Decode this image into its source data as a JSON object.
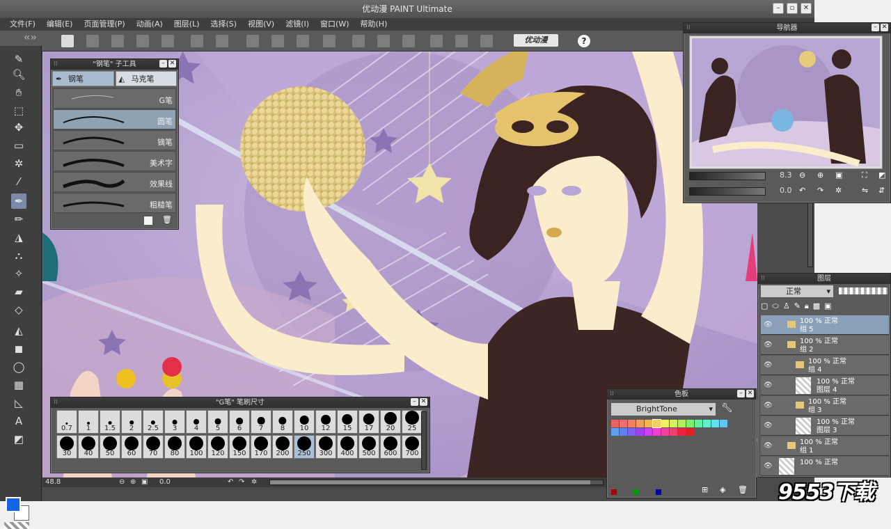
{
  "app": {
    "title": "优动漫 PAINT Ultimate"
  },
  "menu": [
    "文件(F)",
    "编辑(E)",
    "页面管理(P)",
    "动画(A)",
    "图层(L)",
    "选择(S)",
    "视图(V)",
    "滤镜(I)",
    "窗口(W)",
    "帮助(H)"
  ],
  "toolbar": {
    "logo": "优动漫",
    "help": "?"
  },
  "subtool_panel": {
    "title": "\"钢笔\" 子工具",
    "tabs": [
      "钢笔",
      "马克笔"
    ],
    "brushes": [
      "G笔",
      "圆笔",
      "镝笔",
      "美术字",
      "效果线",
      "粗糙笔"
    ],
    "selected_brush": "圆笔"
  },
  "brush_size_panel": {
    "title": "\"G笔\" 笔刷尺寸",
    "row1": [
      "0.7",
      "1",
      "1.5",
      "2",
      "2.5",
      "3",
      "4",
      "5",
      "6",
      "7",
      "8",
      "10",
      "12",
      "15",
      "17",
      "20",
      "25"
    ],
    "row2": [
      "30",
      "40",
      "50",
      "60",
      "70",
      "80",
      "100",
      "120",
      "150",
      "170",
      "200",
      "250",
      "300",
      "400",
      "500",
      "600",
      "700"
    ],
    "selected": "250"
  },
  "navigator_panel": {
    "title": "导航器",
    "zoom": "8.3",
    "angle": "0.0"
  },
  "color_panel": {
    "title": "色板",
    "palette": "BrightTone",
    "colors_row1": [
      "#f06060",
      "#f07070",
      "#f08060",
      "#f0a060",
      "#f0b850",
      "#f0d060",
      "#f0f060",
      "#d8f060",
      "#b0f060",
      "#80f070",
      "#60f0a0",
      "#60f0d0",
      "#60e0f0",
      "#60c8f0"
    ],
    "colors_row2": [
      "#60a0f0",
      "#6080f0",
      "#8060f0",
      "#a040f0",
      "#d040f0",
      "#f040d0",
      "#f040a0",
      "#f04070",
      "#f02040",
      "#e02020"
    ]
  },
  "layer_panel": {
    "title": "图层",
    "blend_mode": "正常",
    "layers": [
      {
        "line1": "100 % 正常",
        "line2": "组 5",
        "indent": 0,
        "selected": true
      },
      {
        "line1": "100 % 正常",
        "line2": "组 2",
        "indent": 0,
        "selected": false
      },
      {
        "line1": "100 % 正常",
        "line2": "组 4",
        "indent": 1,
        "selected": false
      },
      {
        "line1": "100 % 正常",
        "line2": "图层 4",
        "indent": 2,
        "selected": false
      },
      {
        "line1": "100 % 正常",
        "line2": "组 3",
        "indent": 1,
        "selected": false
      },
      {
        "line1": "100 % 正常",
        "line2": "图层 3",
        "indent": 2,
        "selected": false
      },
      {
        "line1": "100 % 正常",
        "line2": "组 1",
        "indent": 0,
        "selected": false
      },
      {
        "line1": "100 % 正常",
        "line2": "",
        "indent": 0,
        "selected": false
      }
    ]
  },
  "status": {
    "zoom": "48.8",
    "angle": "0.0"
  },
  "watermark": "9553下载"
}
